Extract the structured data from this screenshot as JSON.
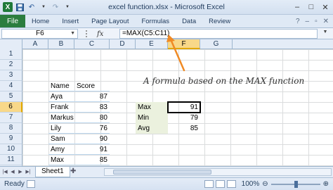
{
  "window": {
    "title": "excel function.xlsx - Microsoft Excel",
    "controls": [
      "minimize",
      "maximize",
      "close"
    ]
  },
  "ribbon": {
    "file_tab": "File",
    "tabs": [
      "Home",
      "Insert",
      "Page Layout",
      "Formulas",
      "Data",
      "Review"
    ]
  },
  "formula_bar": {
    "name_box": "F6",
    "fx": "fx",
    "formula": "=MAX(C5:C11)"
  },
  "grid": {
    "columns": [
      "A",
      "B",
      "C",
      "D",
      "E",
      "F",
      "G"
    ],
    "rows": [
      "1",
      "2",
      "3",
      "4",
      "5",
      "6",
      "7",
      "8",
      "9",
      "10",
      "11",
      "12"
    ],
    "selected_column": "F",
    "selected_row": "6"
  },
  "annotation": "A formula based on the MAX function",
  "table": {
    "header_name": "Name",
    "header_score": "Score",
    "rows": [
      {
        "name": "Aya",
        "score": "87"
      },
      {
        "name": "Frank",
        "score": "83"
      },
      {
        "name": "Markus",
        "score": "80"
      },
      {
        "name": "Lily",
        "score": "76"
      },
      {
        "name": "Sam",
        "score": "90"
      },
      {
        "name": "Amy",
        "score": "91"
      },
      {
        "name": "Max",
        "score": "85"
      }
    ]
  },
  "summary": [
    {
      "label": "Max",
      "value": "91"
    },
    {
      "label": "Min",
      "value": "79"
    },
    {
      "label": "Avg",
      "value": "85"
    }
  ],
  "sheets": {
    "active": "Sheet1"
  },
  "status": {
    "text": "Ready",
    "zoom": "100%"
  },
  "colors": {
    "file_tab": "#2b7d3e",
    "selection_header": "#f8d889",
    "summary_fill": "#ebf1de",
    "arrow": "#f08a24"
  }
}
